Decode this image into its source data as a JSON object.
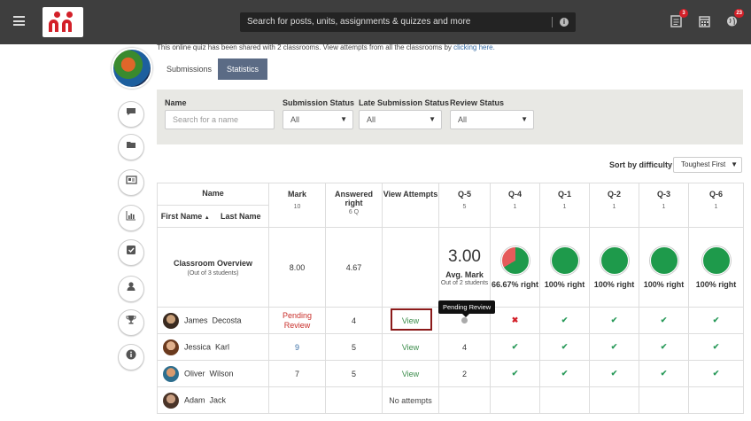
{
  "search": {
    "placeholder": "Search for posts, units, assignments & quizzes and more"
  },
  "header_icons": [
    {
      "icon": "clipboard-icon",
      "badge": "3"
    },
    {
      "icon": "calendar-icon",
      "badge": ""
    },
    {
      "icon": "globe-icon",
      "badge": "23"
    }
  ],
  "notice": {
    "text": "This online quiz has been shared with 2 classrooms. View attempts from all the classrooms by ",
    "link": "clicking here."
  },
  "tabs": [
    "Submissions",
    "Statistics"
  ],
  "filters": {
    "name_label": "Name",
    "name_placeholder": "Search for a name",
    "submission_label": "Submission Status",
    "submission_value": "All",
    "late_label": "Late Submission Status",
    "late_value": "All",
    "review_label": "Review Status",
    "review_value": "All"
  },
  "sort": {
    "label": "Sort by difficulty",
    "value": "Toughest First"
  },
  "table": {
    "name_header": "Name",
    "first_name_header": "First Name",
    "last_name_header": "Last Name",
    "mark_header": "Mark",
    "mark_sub": "10",
    "answered_header": "Answered right",
    "answered_sub": "6 Q",
    "attempts_header": "View Attempts",
    "questions": [
      {
        "label": "Q-5",
        "sub": "5"
      },
      {
        "label": "Q-4",
        "sub": "1"
      },
      {
        "label": "Q-1",
        "sub": "1"
      },
      {
        "label": "Q-2",
        "sub": "1"
      },
      {
        "label": "Q-3",
        "sub": "1"
      },
      {
        "label": "Q-6",
        "sub": "1"
      }
    ],
    "overview": {
      "title": "Classroom Overview",
      "subtitle": "(Out of 3 students)",
      "mark": "8.00",
      "answered": "4.67",
      "avg_value": "3.00",
      "avg_label": "Avg. Mark",
      "avg_sub": "Out of 2 students",
      "q4_pct_right": 66.67,
      "q4_text": "66.67% right",
      "right_text": "100% right"
    },
    "students": [
      {
        "first": "James",
        "last": "Decosta",
        "mark": "Pending Review",
        "answered": "4",
        "attempts": "View",
        "q5": "",
        "q4": "✖",
        "q1": "✔",
        "q2": "✔",
        "q3": "✔",
        "q6": "✔"
      },
      {
        "first": "Jessica",
        "last": "Karl",
        "mark": "9",
        "answered": "5",
        "attempts": "View",
        "q5": "4",
        "q4": "✔",
        "q1": "✔",
        "q2": "✔",
        "q3": "✔",
        "q6": "✔"
      },
      {
        "first": "Oliver",
        "last": "Wilson",
        "mark": "7",
        "answered": "5",
        "attempts": "View",
        "q5": "2",
        "q4": "✔",
        "q1": "✔",
        "q2": "✔",
        "q3": "✔",
        "q6": "✔"
      },
      {
        "first": "Adam",
        "last": "Jack",
        "mark": "",
        "answered": "",
        "attempts": "No attempts",
        "q5": "",
        "q4": "",
        "q1": "",
        "q2": "",
        "q3": "",
        "q6": ""
      }
    ]
  },
  "tooltip": "Pending Review",
  "colors": {
    "topbar": "#3e3e3e",
    "brand": "#d32029",
    "tab_active": "#5b6b85",
    "pie_green": "#1e9a4b",
    "pie_red": "#e55b5b"
  }
}
